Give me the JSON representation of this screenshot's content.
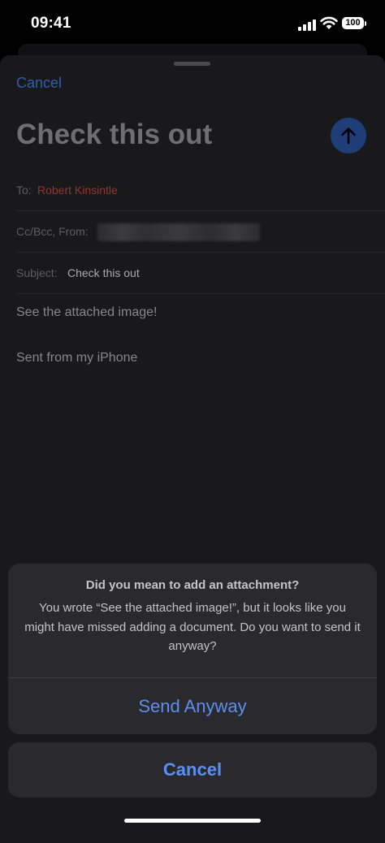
{
  "status_bar": {
    "time": "09:41",
    "battery": "100"
  },
  "compose": {
    "cancel_label": "Cancel",
    "title": "Check this out",
    "to_label": "To:",
    "to_value": "Robert Kinsintle",
    "cc_label": "Cc/Bcc, From:",
    "subject_label": "Subject:",
    "subject_value": "Check this out",
    "body_line1": "See the attached image!",
    "body_line2": "Sent from my iPhone"
  },
  "alert": {
    "title": "Did you mean to add an attachment?",
    "message": "You wrote “See the attached image!”, but it looks like you might have missed adding a document. Do you want to send it anyway?",
    "action_label": "Send Anyway",
    "cancel_label": "Cancel"
  },
  "colors": {
    "accent": "#5b8ff0",
    "recipient": "#93362f",
    "background": "#19191c"
  }
}
